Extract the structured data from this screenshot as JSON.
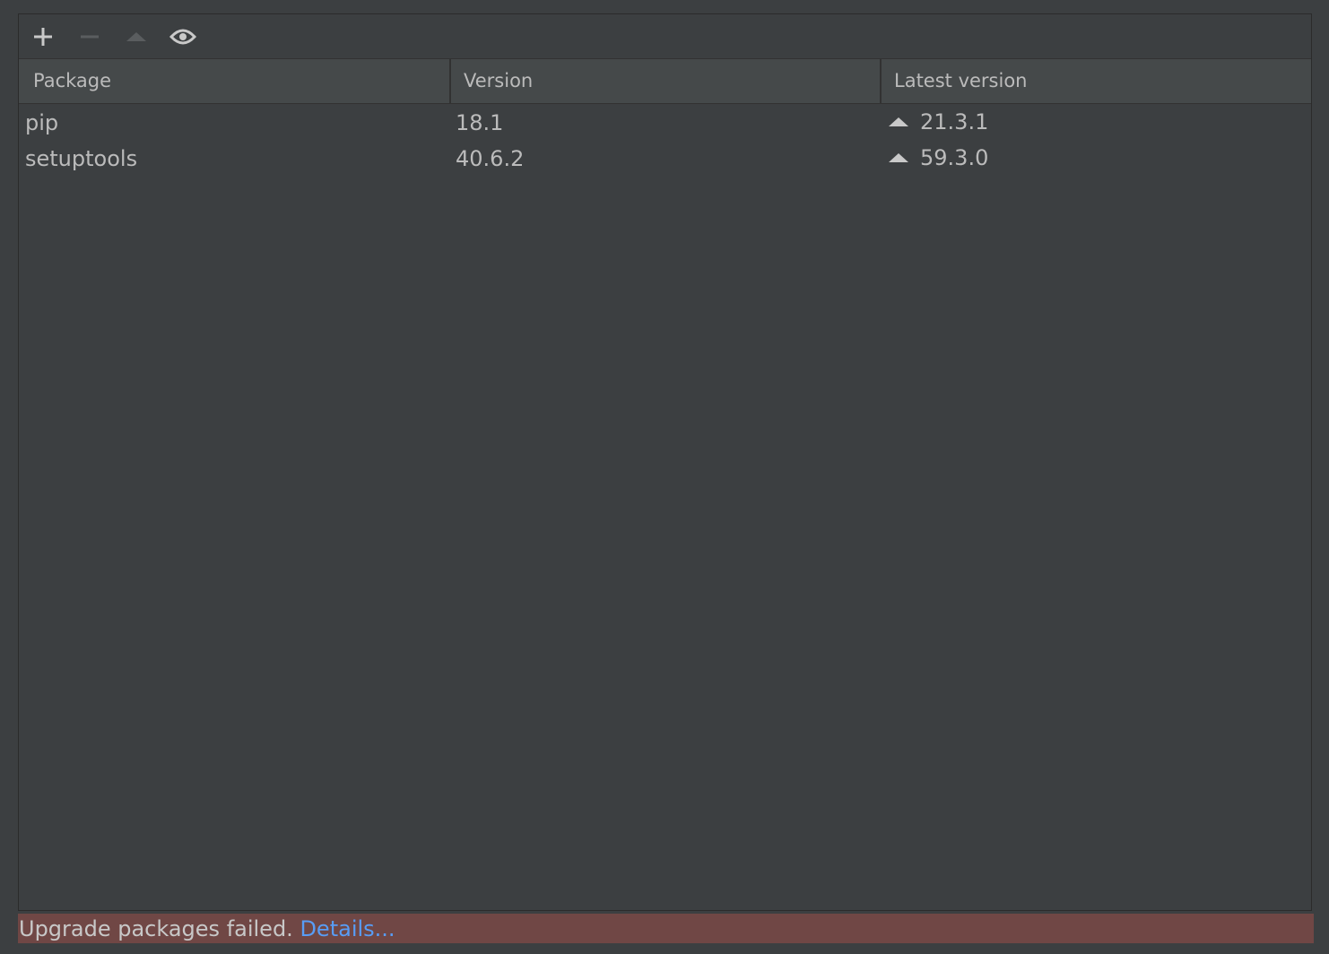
{
  "toolbar": {
    "buttons": [
      {
        "icon": "plus-icon",
        "enabled": true
      },
      {
        "icon": "minus-icon",
        "enabled": false
      },
      {
        "icon": "upgrade-icon",
        "enabled": false
      },
      {
        "icon": "eye-icon",
        "enabled": true
      }
    ]
  },
  "table": {
    "columns": [
      "Package",
      "Version",
      "Latest version"
    ],
    "rows": [
      {
        "package": "pip",
        "version": "18.1",
        "latest": "21.3.1"
      },
      {
        "package": "setuptools",
        "version": "40.6.2",
        "latest": "59.3.0"
      }
    ]
  },
  "status": {
    "message": "Upgrade packages failed.",
    "link": "Details..."
  },
  "colors": {
    "background": "#3c3f41",
    "header": "#45494a",
    "text": "#bbbbbb",
    "error_bar": "#704745",
    "link": "#589df6"
  }
}
